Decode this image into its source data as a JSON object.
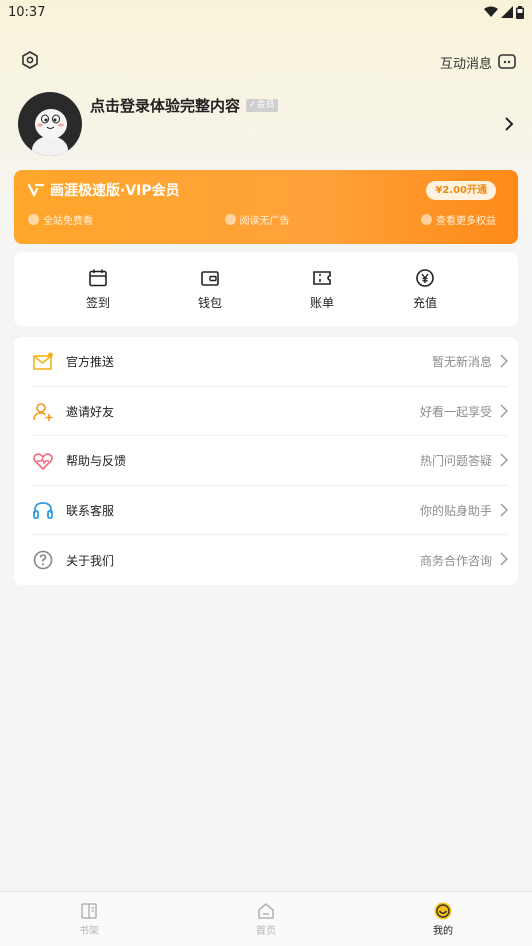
{
  "status_bar": {
    "time": "10:37"
  },
  "header": {
    "settings_icon": "settings-icon",
    "messages_label": "互动消息",
    "messages_icon": "message-icon"
  },
  "profile": {
    "login_prompt": "点击登录体验完整内容",
    "member_tag": "会员"
  },
  "vip": {
    "title": "画涯极速版·VIP会员",
    "price_button": "¥2.00开通",
    "benefits": [
      "全站免费看",
      "阅读无广告",
      "查看更多权益"
    ]
  },
  "quick_actions": [
    {
      "label": "签到",
      "icon": "calendar-icon"
    },
    {
      "label": "钱包",
      "icon": "wallet-icon"
    },
    {
      "label": "账单",
      "icon": "ticket-icon"
    },
    {
      "label": "充值",
      "icon": "yen-coin-icon"
    }
  ],
  "menu": [
    {
      "label": "官方推送",
      "value": "暂无新消息",
      "icon": "mail-icon"
    },
    {
      "label": "邀请好友",
      "value": "好看一起享受",
      "icon": "add-user-icon"
    },
    {
      "label": "帮助与反馈",
      "value": "热门问题答疑",
      "icon": "heart-icon"
    },
    {
      "label": "联系客服",
      "value": "你的贴身助手",
      "icon": "headset-icon"
    },
    {
      "label": "关于我们",
      "value": "商务合作咨询",
      "icon": "help-icon"
    }
  ],
  "bottom_nav": [
    {
      "label": "书架",
      "icon": "bookshelf-icon",
      "active": false
    },
    {
      "label": "首页",
      "icon": "home-icon",
      "active": false
    },
    {
      "label": "我的",
      "icon": "smile-icon",
      "active": true
    }
  ],
  "colors": {
    "accent": "#ffa62b",
    "accent_dark": "#ff8a18",
    "background": "#f5f5f5"
  }
}
